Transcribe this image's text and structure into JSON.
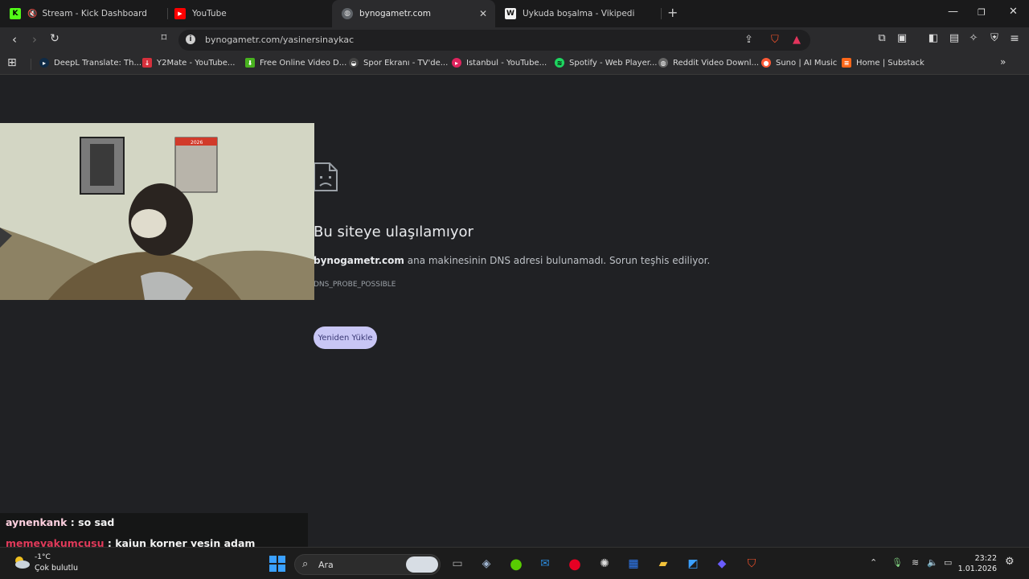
{
  "tabs": [
    {
      "title": "Stream - Kick Dashboard",
      "icon": "kick-icon",
      "muted": true
    },
    {
      "title": "YouTube",
      "icon": "youtube-icon"
    },
    {
      "title": "bynogametr.com",
      "icon": "globe-icon",
      "active": true
    },
    {
      "title": "Uykuda boşalma - Vikipedi",
      "icon": "wikipedia-icon"
    }
  ],
  "address_bar": {
    "url": "bynogametr.com/yasinersinaykac"
  },
  "bookmarks": [
    {
      "label": "DeepL Translate: Th...",
      "color": "#0f2b46"
    },
    {
      "label": "Y2Mate - YouTube...",
      "color": "#d6303c"
    },
    {
      "label": "Free Online Video D...",
      "color": "#48b21f"
    },
    {
      "label": "Spor Ekranı - TV'de...",
      "color": "#444444"
    },
    {
      "label": "Istanbul - YouTube...",
      "color": "#e0245e"
    },
    {
      "label": "Spotify - Web Player...",
      "color": "#1ed760"
    },
    {
      "label": "Reddit Video Downl...",
      "color": "#666666"
    },
    {
      "label": "Suno | AI Music",
      "color": "#ff5a36"
    },
    {
      "label": "Home | Substack",
      "color": "#ff6719"
    }
  ],
  "error_page": {
    "title": "Bu siteye ulaşılamıyor",
    "host": "bynogametr.com",
    "description": "ana makinesinin DNS adresi bulunamadı. Sorun teşhis ediliyor.",
    "code": "DNS_PROBE_POSSIBLE",
    "reload_label": "Yeniden Yükle"
  },
  "webcam": {
    "poster_year": "2026"
  },
  "chat": [
    {
      "user": "aynenkank",
      "sep": " : ",
      "text": "so sad"
    },
    {
      "user": "memevakumcusu",
      "sep": " : ",
      "text": "kajun korner yesin adam"
    }
  ],
  "taskbar": {
    "weather_temp": "-1°C",
    "weather_condition": "Çok bulutlu",
    "search_label": "Ara",
    "time": "23:22",
    "date": "1.01.2026"
  }
}
